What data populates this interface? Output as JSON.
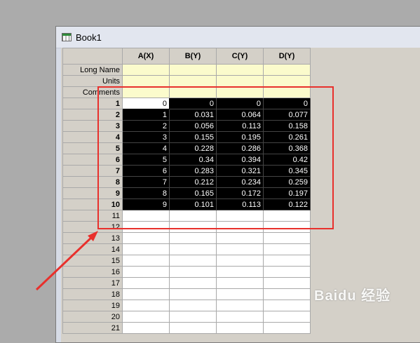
{
  "window": {
    "title": "Book1"
  },
  "columns": [
    {
      "label": "A(X)"
    },
    {
      "label": "B(Y)"
    },
    {
      "label": "C(Y)"
    },
    {
      "label": "D(Y)"
    }
  ],
  "meta_rows": [
    "Long Name",
    "Units",
    "Comments"
  ],
  "data_rows": [
    {
      "n": "1",
      "vals": [
        "0",
        "0",
        "0",
        "0"
      ]
    },
    {
      "n": "2",
      "vals": [
        "1",
        "0.031",
        "0.064",
        "0.077"
      ]
    },
    {
      "n": "3",
      "vals": [
        "2",
        "0.056",
        "0.113",
        "0.158"
      ]
    },
    {
      "n": "4",
      "vals": [
        "3",
        "0.155",
        "0.195",
        "0.261"
      ]
    },
    {
      "n": "5",
      "vals": [
        "4",
        "0.228",
        "0.286",
        "0.368"
      ]
    },
    {
      "n": "6",
      "vals": [
        "5",
        "0.34",
        "0.394",
        "0.42"
      ]
    },
    {
      "n": "7",
      "vals": [
        "6",
        "0.283",
        "0.321",
        "0.345"
      ]
    },
    {
      "n": "8",
      "vals": [
        "7",
        "0.212",
        "0.234",
        "0.259"
      ]
    },
    {
      "n": "9",
      "vals": [
        "8",
        "0.165",
        "0.172",
        "0.197"
      ]
    },
    {
      "n": "10",
      "vals": [
        "9",
        "0.101",
        "0.113",
        "0.122"
      ]
    }
  ],
  "empty_rows": [
    "11",
    "12",
    "13",
    "14",
    "15",
    "16",
    "17",
    "18",
    "19",
    "20",
    "21"
  ],
  "annotation": {
    "box_color": "#e8302c",
    "arrow_color": "#e8302c"
  },
  "watermark": "Baidu 经验"
}
